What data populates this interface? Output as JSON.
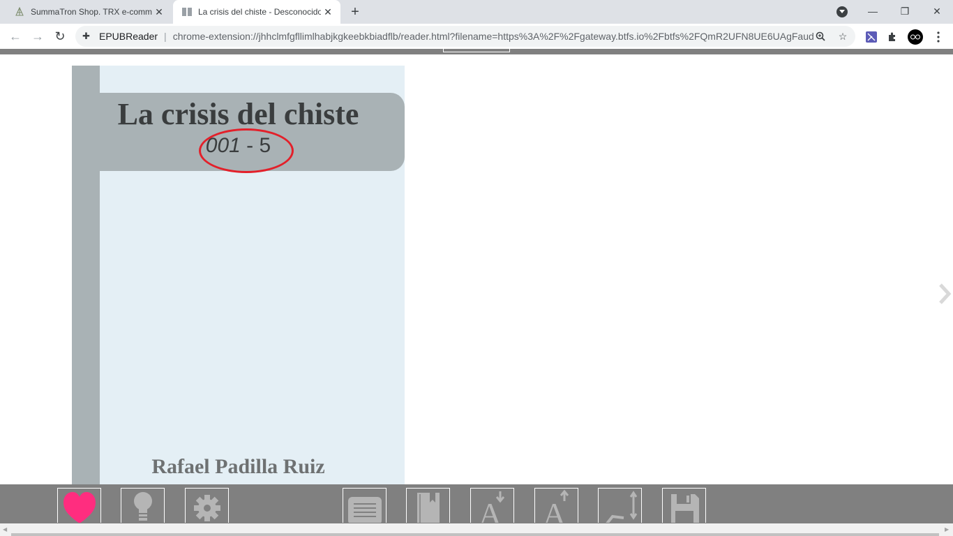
{
  "browser": {
    "tabs": [
      {
        "title": "SummaTron Shop. TRX e-comme",
        "icon": "summatron-icon",
        "active": false
      },
      {
        "title": "La crisis del chiste - Desconocido",
        "icon": "book-icon",
        "active": true
      }
    ],
    "new_tab_label": "+",
    "address": {
      "site": "EPUBReader",
      "separator": "|",
      "url": "chrome-extension://jhhclmfgfllimlhabjkgkeebkbiadflb/reader.html?filename=https%3A%2F%2Fgateway.btfs.io%2Fbtfs%2FQmR2UFN8UE6UAgFaud..."
    }
  },
  "book": {
    "title": "La crisis del chiste",
    "subtitle_number": "001",
    "subtitle_rest": " - 5",
    "author": "Rafael Padilla Ruiz"
  },
  "colors": {
    "cover_background": "#e4eff5",
    "cover_band": "#a9b2b5",
    "annotation_circle": "#e3202a",
    "heart": "#ff2d7f",
    "reader_bar": "#808080"
  },
  "bottom_toolbar": {
    "buttons": [
      "heart-icon",
      "lightbulb-icon",
      "gear-icon",
      "table-of-contents-icon",
      "bookmark-icon",
      "font-decrease-icon",
      "font-increase-icon",
      "line-spacing-icon",
      "save-icon"
    ]
  }
}
